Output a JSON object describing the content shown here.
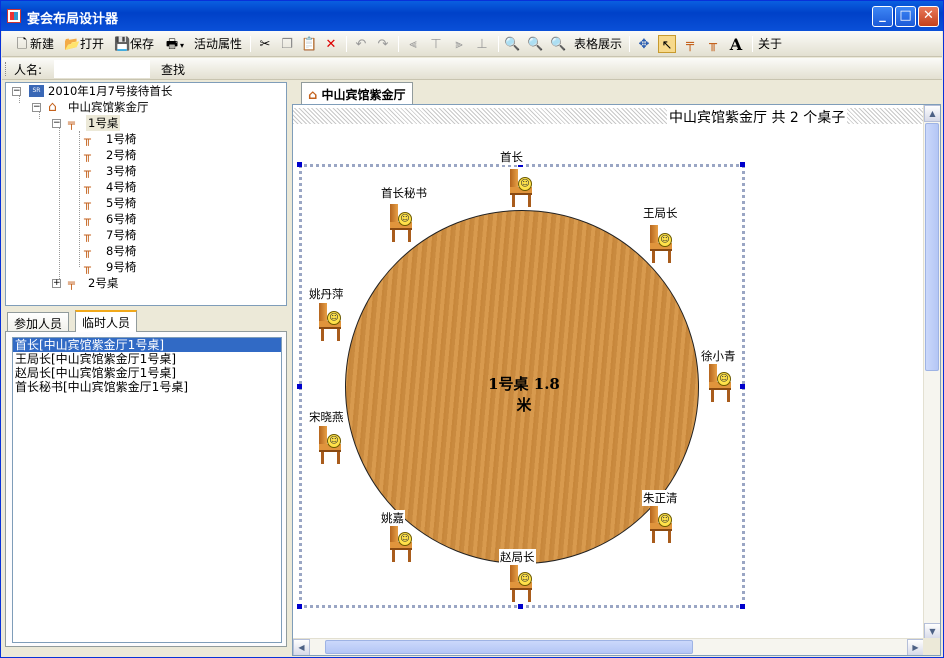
{
  "window": {
    "title": "宴会布局设计器"
  },
  "toolbar": {
    "new_label": "新建",
    "open_label": "打开",
    "save_label": "保存",
    "activity_label": "活动属性",
    "table_view_label": "表格展示",
    "about_label": "关于"
  },
  "search": {
    "name_label": "人名:",
    "name_value": "",
    "find_label": "查找"
  },
  "tree": {
    "root": "2010年1月7号接待首长",
    "venue": "中山宾馆紫金厅",
    "table1": "1号桌",
    "chairs": [
      "1号椅",
      "2号椅",
      "3号椅",
      "4号椅",
      "5号椅",
      "6号椅",
      "7号椅",
      "8号椅",
      "9号椅"
    ],
    "table2": "2号桌"
  },
  "tabs": {
    "participants": "参加人员",
    "temporary": "临时人员"
  },
  "list": {
    "items": [
      "首长[中山宾馆紫金厅1号桌]",
      "王局长[中山宾馆紫金厅1号桌]",
      "赵局长[中山宾馆紫金厅1号桌]",
      "首长秘书[中山宾馆紫金厅1号桌]"
    ]
  },
  "doc": {
    "tab_label": "中山宾馆紫金厅",
    "canvas_title": "中山宾馆紫金厅 共 2 个桌子",
    "table_label": "1号桌 1.8米"
  },
  "seats": [
    "首长",
    "王局长",
    "徐小青",
    "朱正清",
    "赵局长",
    "姚嘉",
    "宋晓燕",
    "姚丹萍",
    "首长秘书"
  ],
  "colors": {
    "titlebar": "#0a50d8",
    "table_wood": "#d08f45",
    "selection": "#316ac5"
  }
}
